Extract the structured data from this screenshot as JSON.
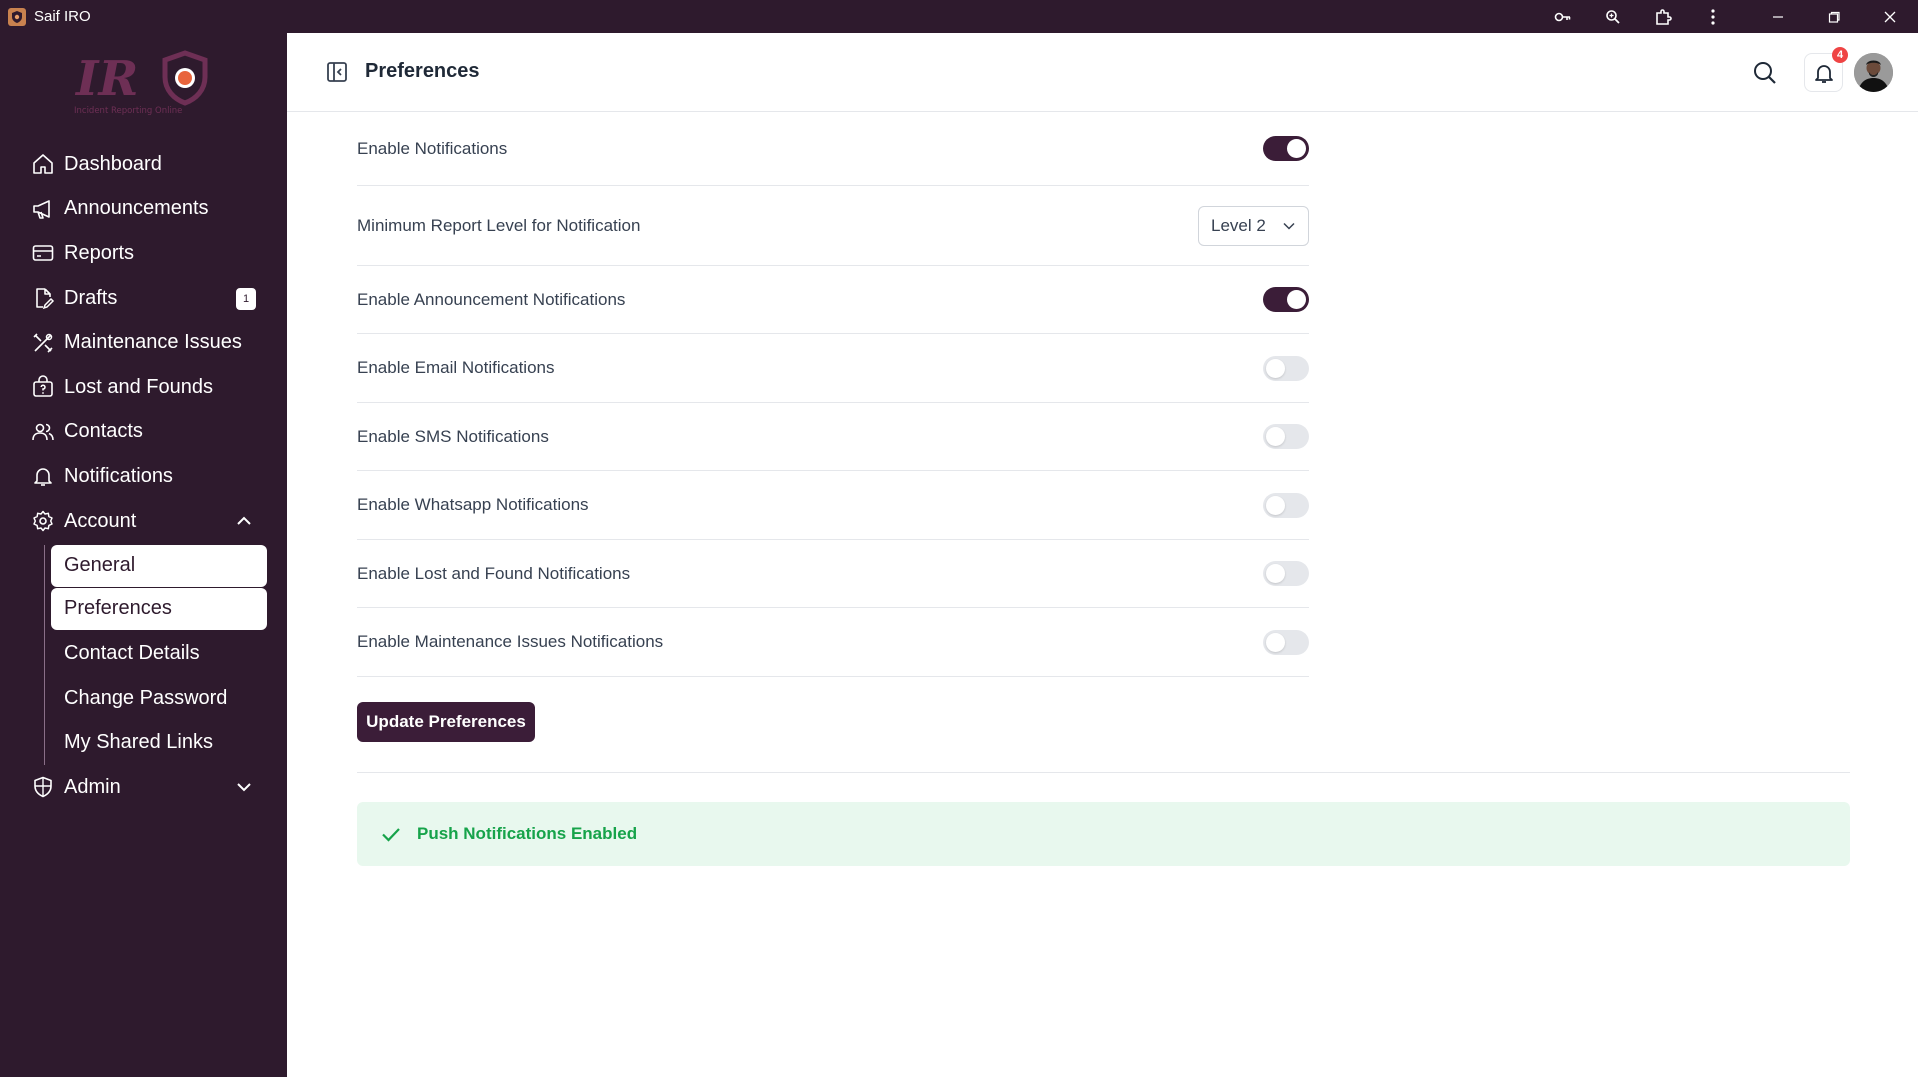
{
  "window": {
    "app_title": "Saif IRO"
  },
  "logo": {
    "letters": "IR",
    "tagline": "Incident Reporting Online"
  },
  "sidebar": {
    "items": [
      {
        "label": "Dashboard",
        "icon": "home-icon"
      },
      {
        "label": "Announcements",
        "icon": "megaphone-icon"
      },
      {
        "label": "Reports",
        "icon": "card-icon"
      },
      {
        "label": "Drafts",
        "icon": "draft-icon",
        "badge": "1"
      },
      {
        "label": "Maintenance Issues",
        "icon": "tools-icon"
      },
      {
        "label": "Lost and Founds",
        "icon": "bag-question-icon"
      },
      {
        "label": "Contacts",
        "icon": "users-icon"
      },
      {
        "label": "Notifications",
        "icon": "bell-icon"
      },
      {
        "label": "Account",
        "icon": "gear-icon",
        "expanded": true
      }
    ],
    "account_sub": [
      {
        "label": "General",
        "highlight": true
      },
      {
        "label": "Preferences",
        "highlight": true
      },
      {
        "label": "Contact Details"
      },
      {
        "label": "Change Password"
      },
      {
        "label": "My Shared Links"
      }
    ],
    "admin": {
      "label": "Admin",
      "icon": "shield-icon",
      "expanded": false
    }
  },
  "header": {
    "title": "Preferences",
    "notification_count": "4"
  },
  "settings": [
    {
      "label": "Enable Notifications",
      "type": "toggle",
      "on": true
    },
    {
      "label": "Minimum Report Level for Notification",
      "type": "select",
      "value": "Level 2"
    },
    {
      "label": "Enable Announcement Notifications",
      "type": "toggle",
      "on": true
    },
    {
      "label": "Enable Email Notifications",
      "type": "toggle",
      "on": false
    },
    {
      "label": "Enable SMS Notifications",
      "type": "toggle",
      "on": false
    },
    {
      "label": "Enable Whatsapp Notifications",
      "type": "toggle",
      "on": false
    },
    {
      "label": "Enable Lost and Found Notifications",
      "type": "toggle",
      "on": false
    },
    {
      "label": "Enable Maintenance Issues Notifications",
      "type": "toggle",
      "on": false
    }
  ],
  "update_button": "Update Preferences",
  "alert": {
    "text": "Push Notifications Enabled"
  },
  "colors": {
    "sidebar_bg": "#2e1a2d",
    "primary": "#3b1d38",
    "success_text": "#16a34a",
    "success_bg": "#e8f8ee",
    "badge_red": "#ef4444"
  }
}
